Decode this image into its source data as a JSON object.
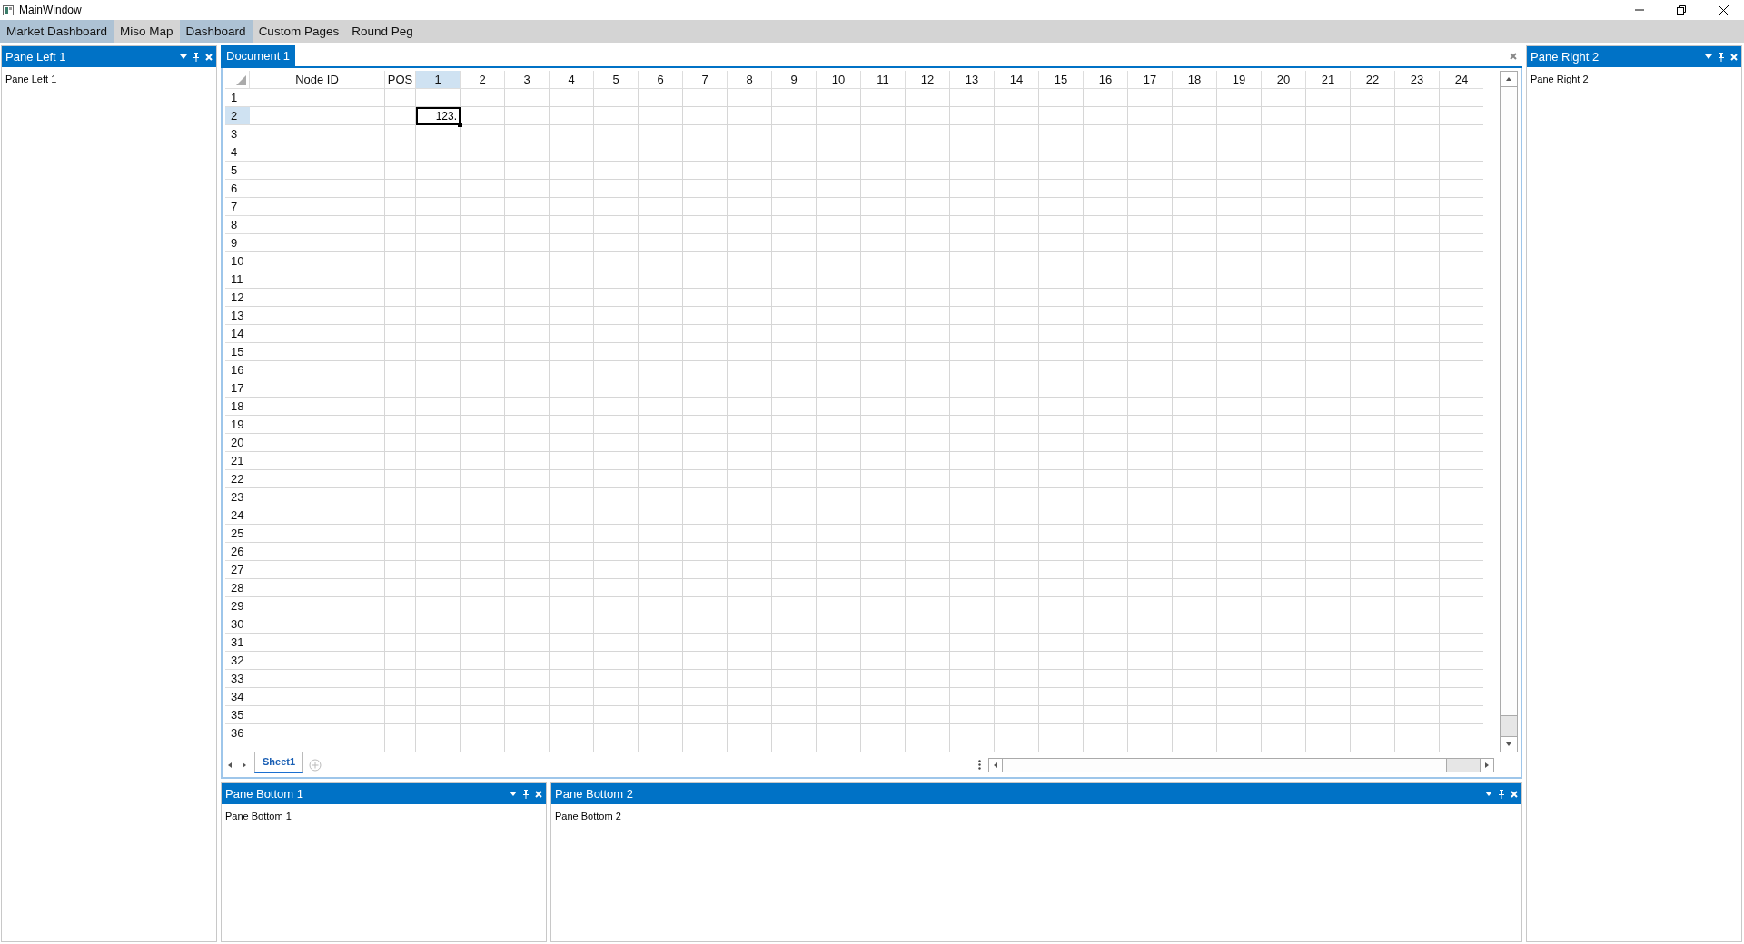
{
  "window": {
    "title": "MainWindow"
  },
  "menu": [
    {
      "label": "Market Dashboard",
      "selected": true
    },
    {
      "label": "Miso Map",
      "selected": false
    },
    {
      "label": "Dashboard",
      "selected": true
    },
    {
      "label": "Custom Pages",
      "selected": false
    },
    {
      "label": "Round Peg",
      "selected": false
    }
  ],
  "pane_left": {
    "title": "Pane Left 1",
    "content": "Pane Left 1"
  },
  "document": {
    "tab": "Document 1",
    "grid": {
      "columns": [
        {
          "label": "Node ID",
          "selected": false
        },
        {
          "label": "POS",
          "selected": false
        },
        {
          "label": "1",
          "selected": true
        },
        {
          "label": "2",
          "selected": false
        },
        {
          "label": "3",
          "selected": false
        },
        {
          "label": "4",
          "selected": false
        },
        {
          "label": "5",
          "selected": false
        },
        {
          "label": "6",
          "selected": false
        },
        {
          "label": "7",
          "selected": false
        },
        {
          "label": "8",
          "selected": false
        },
        {
          "label": "9",
          "selected": false
        },
        {
          "label": "10",
          "selected": false
        },
        {
          "label": "11",
          "selected": false
        },
        {
          "label": "12",
          "selected": false
        },
        {
          "label": "13",
          "selected": false
        },
        {
          "label": "14",
          "selected": false
        },
        {
          "label": "15",
          "selected": false
        },
        {
          "label": "16",
          "selected": false
        },
        {
          "label": "17",
          "selected": false
        },
        {
          "label": "18",
          "selected": false
        },
        {
          "label": "19",
          "selected": false
        },
        {
          "label": "20",
          "selected": false
        },
        {
          "label": "21",
          "selected": false
        },
        {
          "label": "22",
          "selected": false
        },
        {
          "label": "23",
          "selected": false
        },
        {
          "label": "24",
          "selected": false
        }
      ],
      "rows": [
        {
          "label": "1",
          "selected": false
        },
        {
          "label": "2",
          "selected": true
        },
        {
          "label": "3",
          "selected": false
        },
        {
          "label": "4",
          "selected": false
        },
        {
          "label": "5",
          "selected": false
        },
        {
          "label": "6",
          "selected": false
        },
        {
          "label": "7",
          "selected": false
        },
        {
          "label": "8",
          "selected": false
        },
        {
          "label": "9",
          "selected": false
        },
        {
          "label": "10",
          "selected": false
        },
        {
          "label": "11",
          "selected": false
        },
        {
          "label": "12",
          "selected": false
        },
        {
          "label": "13",
          "selected": false
        },
        {
          "label": "14",
          "selected": false
        },
        {
          "label": "15",
          "selected": false
        },
        {
          "label": "16",
          "selected": false
        },
        {
          "label": "17",
          "selected": false
        },
        {
          "label": "18",
          "selected": false
        },
        {
          "label": "19",
          "selected": false
        },
        {
          "label": "20",
          "selected": false
        },
        {
          "label": "21",
          "selected": false
        },
        {
          "label": "22",
          "selected": false
        },
        {
          "label": "23",
          "selected": false
        },
        {
          "label": "24",
          "selected": false
        },
        {
          "label": "25",
          "selected": false
        },
        {
          "label": "26",
          "selected": false
        },
        {
          "label": "27",
          "selected": false
        },
        {
          "label": "28",
          "selected": false
        },
        {
          "label": "29",
          "selected": false
        },
        {
          "label": "30",
          "selected": false
        },
        {
          "label": "31",
          "selected": false
        },
        {
          "label": "32",
          "selected": false
        },
        {
          "label": "33",
          "selected": false
        },
        {
          "label": "34",
          "selected": false
        },
        {
          "label": "35",
          "selected": false
        },
        {
          "label": "36",
          "selected": false
        }
      ],
      "active_cell": {
        "value": "123."
      }
    },
    "sheets": [
      {
        "label": "Sheet1",
        "selected": true
      }
    ]
  },
  "pane_right": {
    "title": "Pane Right 2",
    "content": "Pane Right 2"
  },
  "panes_bottom": [
    {
      "title": "Pane Bottom 1",
      "content": "Pane Bottom 1"
    },
    {
      "title": "Pane Bottom 2",
      "content": "Pane Bottom 2"
    }
  ]
}
